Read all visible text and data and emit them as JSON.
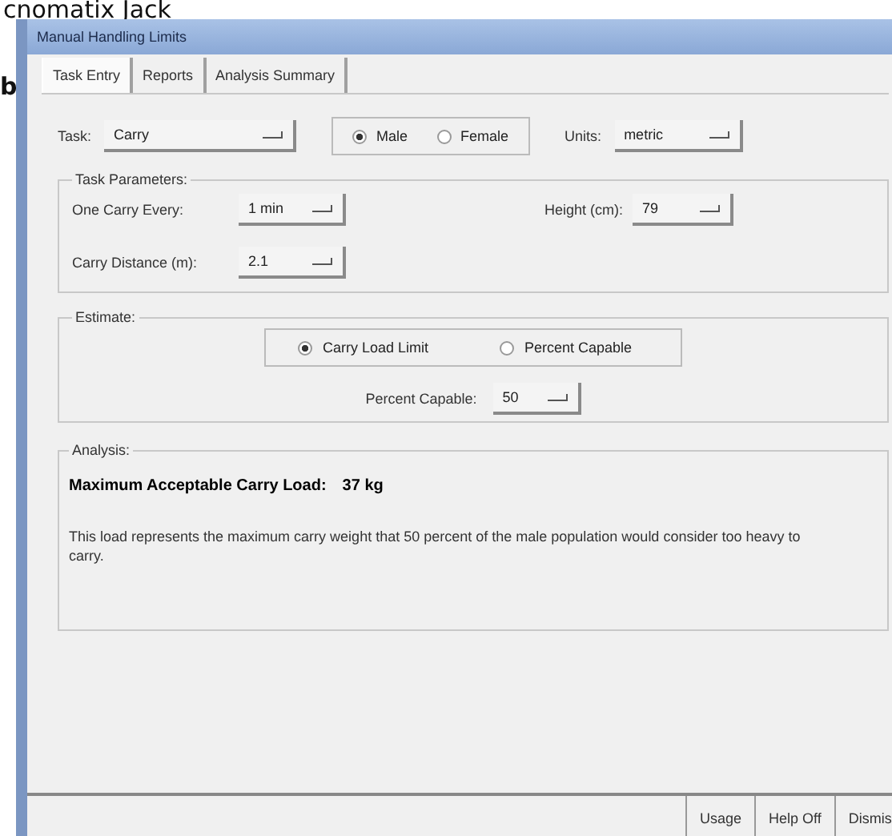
{
  "background": {
    "heading": "cnomatix Jack",
    "side_letter": "b"
  },
  "window": {
    "title": "Manual Handling Limits"
  },
  "tabs": [
    {
      "label": "Task Entry",
      "selected": true
    },
    {
      "label": "Reports",
      "selected": false
    },
    {
      "label": "Analysis Summary",
      "selected": false
    }
  ],
  "task": {
    "label": "Task:",
    "value": "Carry"
  },
  "gender": [
    {
      "label": "Male",
      "selected": true
    },
    {
      "label": "Female",
      "selected": false
    }
  ],
  "units": {
    "label": "Units:",
    "value": "metric"
  },
  "task_parameters": {
    "title": "Task Parameters:",
    "fields": [
      {
        "label": "One Carry Every:",
        "value": "1 min"
      },
      {
        "label": "Height (cm):",
        "value": "79"
      },
      {
        "label": "Carry Distance (m):",
        "value": "2.1"
      }
    ]
  },
  "estimate": {
    "title": "Estimate:",
    "options": [
      {
        "label": "Carry Load Limit",
        "selected": true
      },
      {
        "label": "Percent Capable",
        "selected": false
      }
    ],
    "percent_label": "Percent Capable:",
    "percent_value": "50"
  },
  "analysis": {
    "title": "Analysis:",
    "result_label": "Maximum Acceptable Carry Load:",
    "result_value": "37 kg",
    "text": "This load represents the maximum carry weight that 50 percent of the male population would consider too heavy to carry."
  },
  "buttons": [
    "Usage",
    "Help Off",
    "Dismis"
  ]
}
